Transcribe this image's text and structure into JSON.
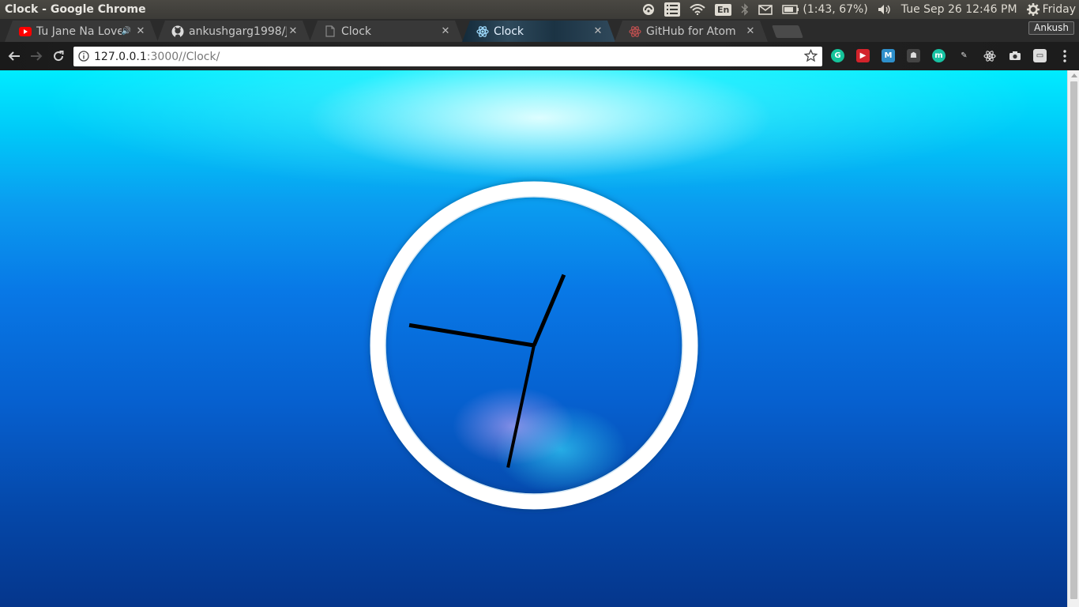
{
  "window": {
    "title": "Clock - Google Chrome"
  },
  "panel": {
    "language": "En",
    "battery": "(1:43, 67%)",
    "datetime": "Tue Sep 26 12:46 PM",
    "user": "Friday"
  },
  "tabs": [
    {
      "title": "Tu Jane Na Love",
      "favicon": "youtube-icon",
      "audio": true,
      "active": false
    },
    {
      "title": "ankushgarg1998/J",
      "favicon": "github-icon",
      "audio": false,
      "active": false
    },
    {
      "title": "Clock",
      "favicon": "page-icon",
      "audio": false,
      "active": false
    },
    {
      "title": "Clock",
      "favicon": "atom-icon",
      "audio": false,
      "active": true
    },
    {
      "title": "GitHub for Atom",
      "favicon": "atom-icon",
      "audio": false,
      "active": false
    }
  ],
  "profile": {
    "name": "Ankush"
  },
  "omnibox": {
    "host": "127.0.0.1",
    "rest": ":3000//Clock/"
  },
  "extensions": [
    "grammarly-icon",
    "pocket-icon",
    "m-icon",
    "evernote-icon",
    "mercury-icon",
    "stylus-icon",
    "react-icon",
    "camera-icon",
    "chat-icon"
  ],
  "clock": {
    "time": {
      "hours": 12,
      "minutes": 46,
      "seconds": 32
    },
    "face_color": "#ffffff",
    "hand_color": "#000000"
  },
  "colors": {
    "panel": "#3c3b37",
    "tab_strip": "#2b2b2b",
    "youtube_red": "#ff0000",
    "page_top": "#00ecff",
    "page_bottom": "#05368c"
  }
}
